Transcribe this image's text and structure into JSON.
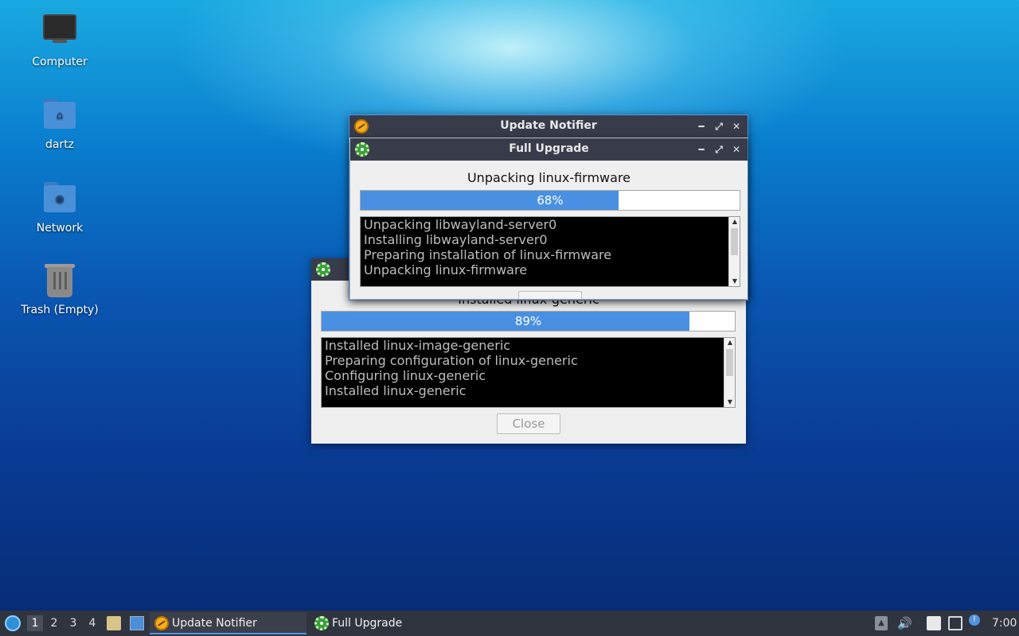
{
  "desktop": {
    "icons": [
      {
        "label": "Computer",
        "icon": "computer-icon"
      },
      {
        "label": "dartz",
        "icon": "home-folder-icon"
      },
      {
        "label": "Network",
        "icon": "network-folder-icon"
      },
      {
        "label": "Trash (Empty)",
        "icon": "trash-icon"
      }
    ]
  },
  "update_notifier_window": {
    "title": "Update Notifier",
    "controls": [
      "minimize",
      "maximize",
      "close"
    ]
  },
  "full_upgrade_window": {
    "title": "Full Upgrade",
    "status": "Unpacking linux-firmware",
    "progress": 68,
    "progress_label": "68%",
    "log": [
      "Unpacking libwayland-server0",
      "Installing libwayland-server0",
      "Preparing installation of linux-firmware",
      "Unpacking linux-firmware"
    ]
  },
  "background_upgrade_window": {
    "status": "Installed linux-generic",
    "progress": 89,
    "progress_label": "89%",
    "log": [
      "Installed linux-image-generic",
      "Preparing configuration of linux-generic",
      "Configuring linux-generic",
      "Installed linux-generic"
    ],
    "close_label": "Close"
  },
  "taskbar": {
    "workspaces": [
      "1",
      "2",
      "3",
      "4"
    ],
    "active_workspace": "1",
    "tasks": [
      {
        "label": "Update Notifier",
        "icon": "update-notifier-icon",
        "active": true
      },
      {
        "label": "Full Upgrade",
        "icon": "gear-icon",
        "active": false
      }
    ],
    "clock": "7:00"
  },
  "colors": {
    "accent": "#4a90e2",
    "titlebar": "#383c4a",
    "taskbar": "#2f343f"
  }
}
